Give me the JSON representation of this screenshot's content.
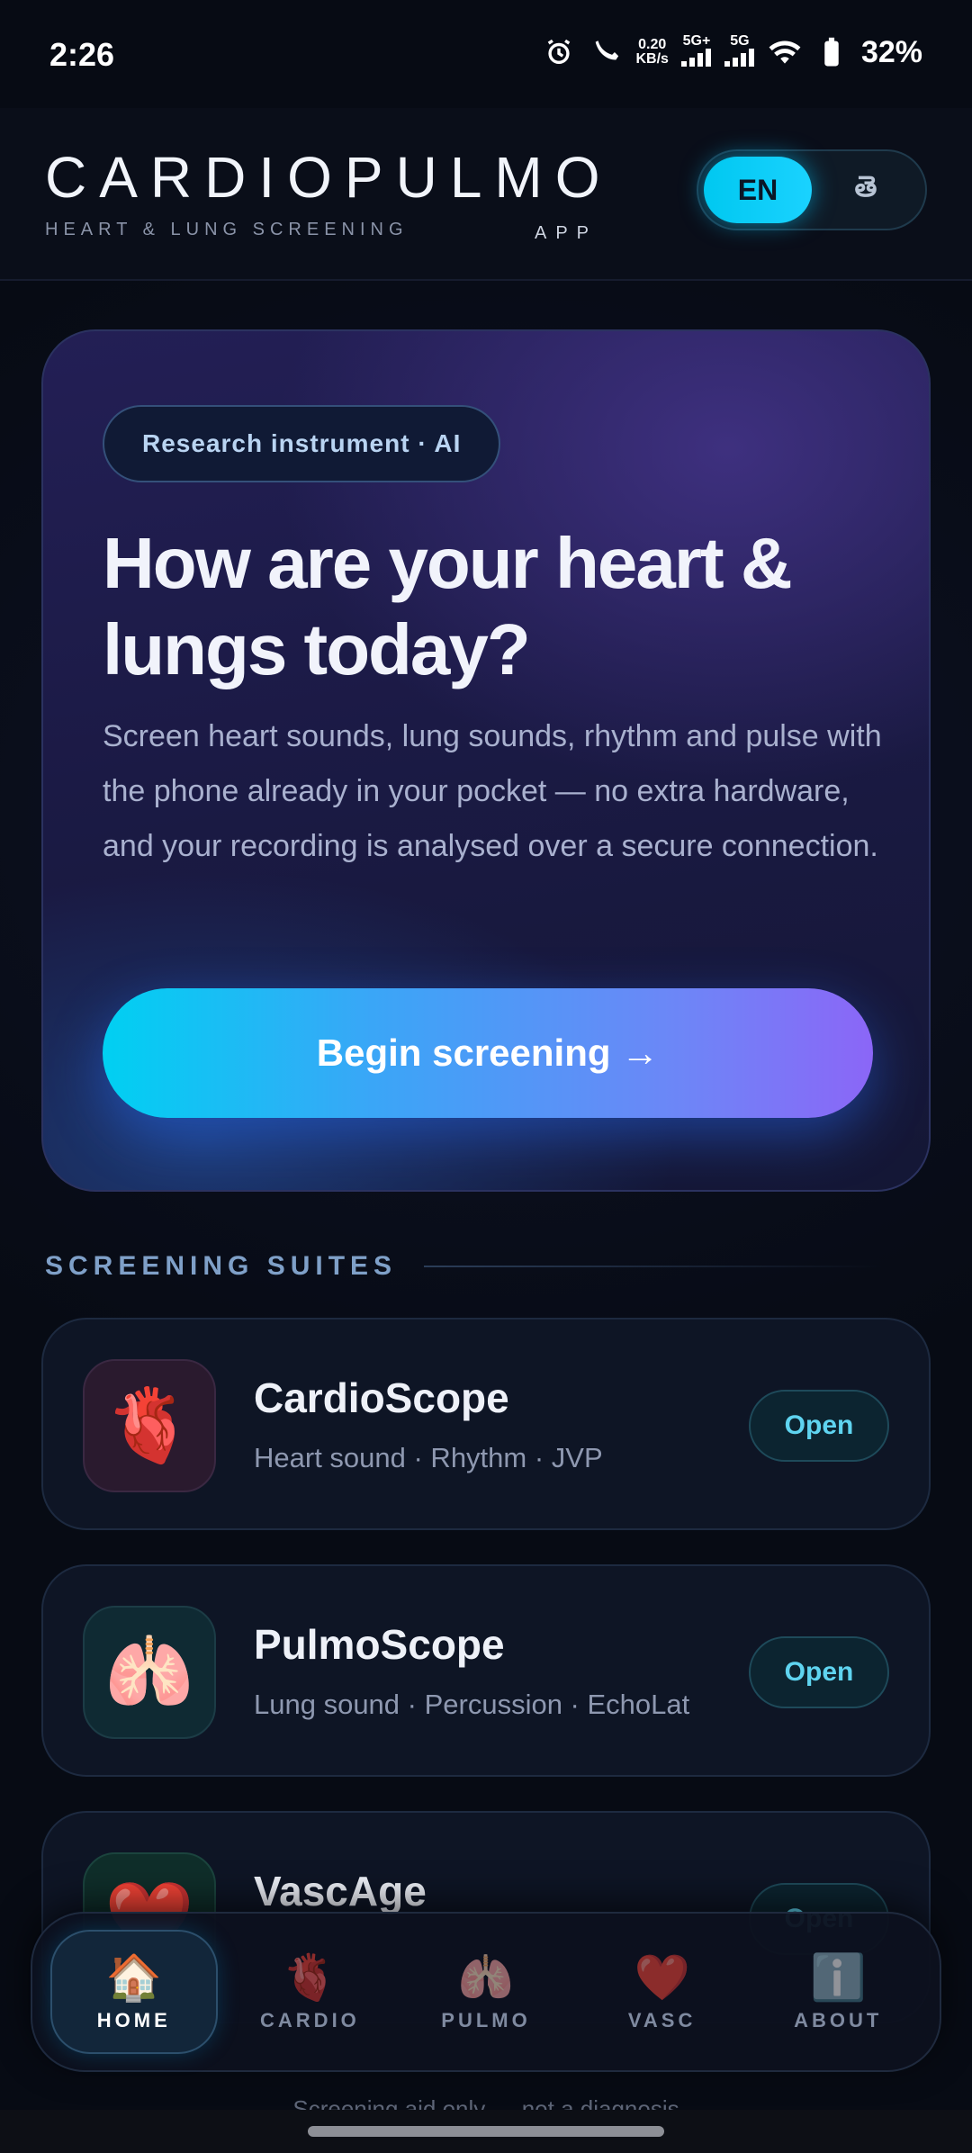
{
  "status_bar": {
    "time": "2:26",
    "net_speed": "0.20",
    "net_unit": "KB/s",
    "signal1": "5G+",
    "signal2": "5G",
    "battery": "32%"
  },
  "header": {
    "brand": "CARDIOPULMO",
    "tagline": "HEART & LUNG SCREENING",
    "tagline_suffix": "APP",
    "lang_en": "EN",
    "lang_te": "తె"
  },
  "hero": {
    "chip": "Research instrument · AI",
    "title": "How are your heart & lungs today?",
    "body": "Screen heart sounds, lung sounds, rhythm and pulse with the phone already in your pocket — no extra hardware, and your recording is analysed over a secure connection.",
    "cta": "Begin screening →"
  },
  "section": {
    "label": "SCREENING SUITES"
  },
  "suites": [
    {
      "icon": "🫀",
      "title": "CardioScope",
      "subtitle": "Heart sound · Rhythm · JVP",
      "action": "Open",
      "icon_bg": "#2a1a2e"
    },
    {
      "icon": "🫁",
      "title": "PulmoScope",
      "subtitle": "Lung sound · Percussion · EchoLat",
      "action": "Open",
      "icon_bg": "#0f2a33"
    },
    {
      "icon": "❤️",
      "title": "VascAge",
      "subtitle": "",
      "action": "Open",
      "icon_bg": "#0f2e2a"
    }
  ],
  "footer_note": "Screening aid only — not a diagnosis",
  "nav": [
    {
      "icon": "🏠",
      "label": "HOME",
      "active": true
    },
    {
      "icon": "🫀",
      "label": "CARDIO",
      "active": false
    },
    {
      "icon": "🫁",
      "label": "PULMO",
      "active": false
    },
    {
      "icon": "❤️",
      "label": "VASC",
      "active": false
    },
    {
      "icon": "ℹ️",
      "label": "ABOUT",
      "active": false
    }
  ],
  "colors": {
    "accent_cyan": "#00d0f2",
    "accent_violet": "#8b66f7",
    "background": "#070b14"
  }
}
